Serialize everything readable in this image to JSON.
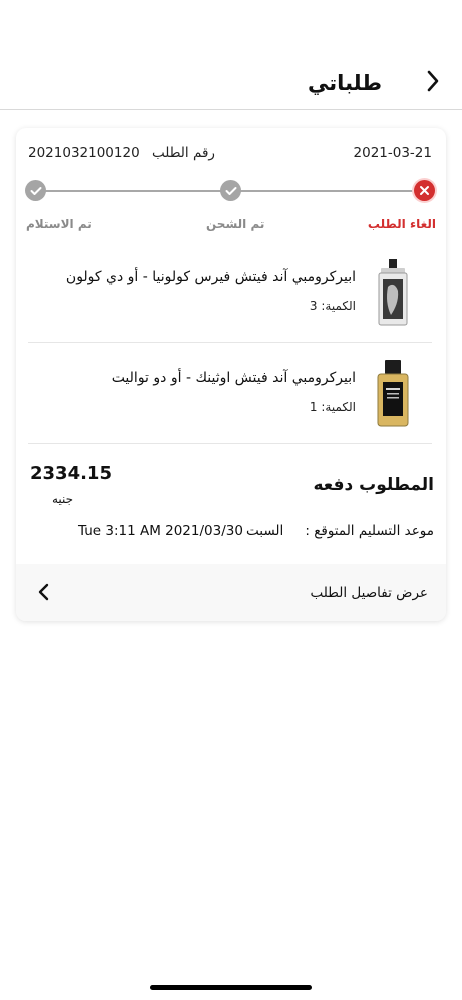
{
  "header": {
    "title": "طلباتي",
    "back_icon": "chevron-right-icon"
  },
  "order": {
    "date": "2021-03-21",
    "number_label": "رقم الطلب",
    "number": "2021032100120"
  },
  "progress": {
    "steps": [
      {
        "label": "الغاء الطلب",
        "state": "cancelled",
        "icon": "close-icon",
        "color": "#d32f2f"
      },
      {
        "label": "تم الشحن",
        "state": "done",
        "icon": "check-icon",
        "color": "#a5a5a5"
      },
      {
        "label": "تم الاستلام",
        "state": "done",
        "icon": "check-icon",
        "color": "#a5a5a5"
      }
    ]
  },
  "products": [
    {
      "name": "ابيركرومبي آند فيتش فيرس كولونيا - أو دي كولون",
      "qty": "الكمية: 3"
    },
    {
      "name": "ابيركرومبي آند فيتش اوثينك - أو دو تواليت",
      "qty": "الكمية: 1"
    }
  ],
  "summary": {
    "total_label": "المطلوب دفعه",
    "total_amount": "2334.15",
    "currency": "جنيه",
    "delivery_label": "موعد التسليم المتوقع :",
    "delivery_day": "السبت",
    "delivery_value": "Tue 3:11 AM 2021/03/30"
  },
  "details_link": {
    "label": "عرض تفاصيل الطلب",
    "icon": "chevron-left-icon"
  },
  "colors": {
    "accent_red": "#d32f2f",
    "step_gray": "#a5a5a5"
  }
}
